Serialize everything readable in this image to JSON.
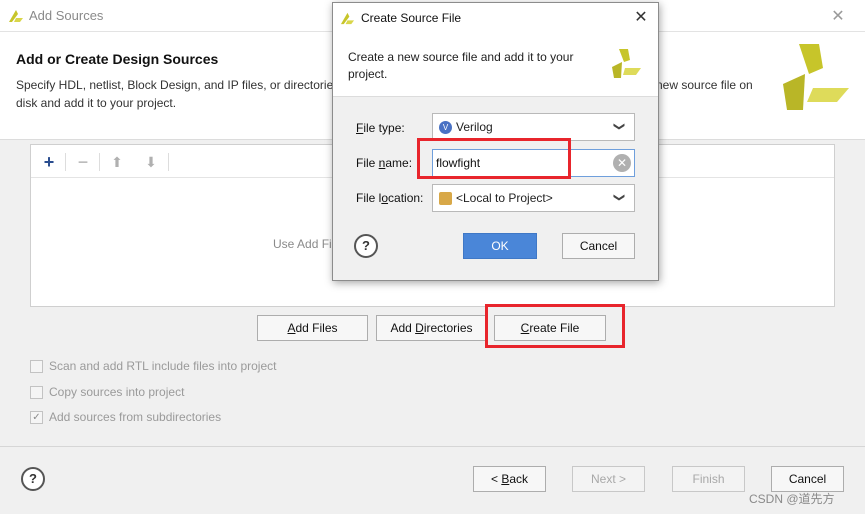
{
  "window": {
    "title": "Add Sources",
    "close_glyph": "✕"
  },
  "header": {
    "title": "Add or Create Design Sources",
    "desc_line1": "Specify HDL, netlist, Block Design, and IP files, or directorie",
    "desc_line2": "disk and add it to your project.",
    "desc_right": "new source file on"
  },
  "toolbar": {
    "add_glyph": "+",
    "remove_glyph": "−",
    "up_glyph": "⬆",
    "down_glyph": "⬇"
  },
  "list": {
    "empty_hint": "Use Add Fi"
  },
  "buttons": {
    "add_files_key": "A",
    "add_files_rest": "dd Files",
    "add_dirs_pre": "Add ",
    "add_dirs_key": "D",
    "add_dirs_rest": "irectories",
    "create_file_key": "C",
    "create_file_rest": "reate File"
  },
  "options": {
    "scan_rtl": "Scan and add RTL include files into project",
    "copy_sources": "Copy sources into project",
    "add_subdirs": "Add sources from subdirectories",
    "checkmark": "✓"
  },
  "footer": {
    "help": "?",
    "back_pre": "< ",
    "back_key": "B",
    "back_rest": "ack",
    "next": "Next >",
    "finish": "Finish",
    "cancel": "Cancel",
    "watermark": "CSDN @道先方"
  },
  "dialog": {
    "title": "Create Source File",
    "close_glyph": "✕",
    "description": "Create a new source file and add it to your project.",
    "file_type_label_key": "F",
    "file_type_label_rest": "ile type:",
    "file_type_value": "Verilog",
    "file_type_icon": "V",
    "file_name_label_pre": "File ",
    "file_name_label_key": "n",
    "file_name_label_rest": "ame:",
    "file_name_value": "flowfight",
    "clear_glyph": "✕",
    "file_location_label_pre": "File l",
    "file_location_label_key": "o",
    "file_location_label_rest": "cation:",
    "file_location_value": "<Local to Project>",
    "dropdown_glyph": "❯",
    "help": "?",
    "ok": "OK",
    "cancel": "Cancel"
  },
  "colors": {
    "highlight": "#e8252c",
    "primary_button": "#4a86d8",
    "logo_yellow": "#c7c52a"
  }
}
